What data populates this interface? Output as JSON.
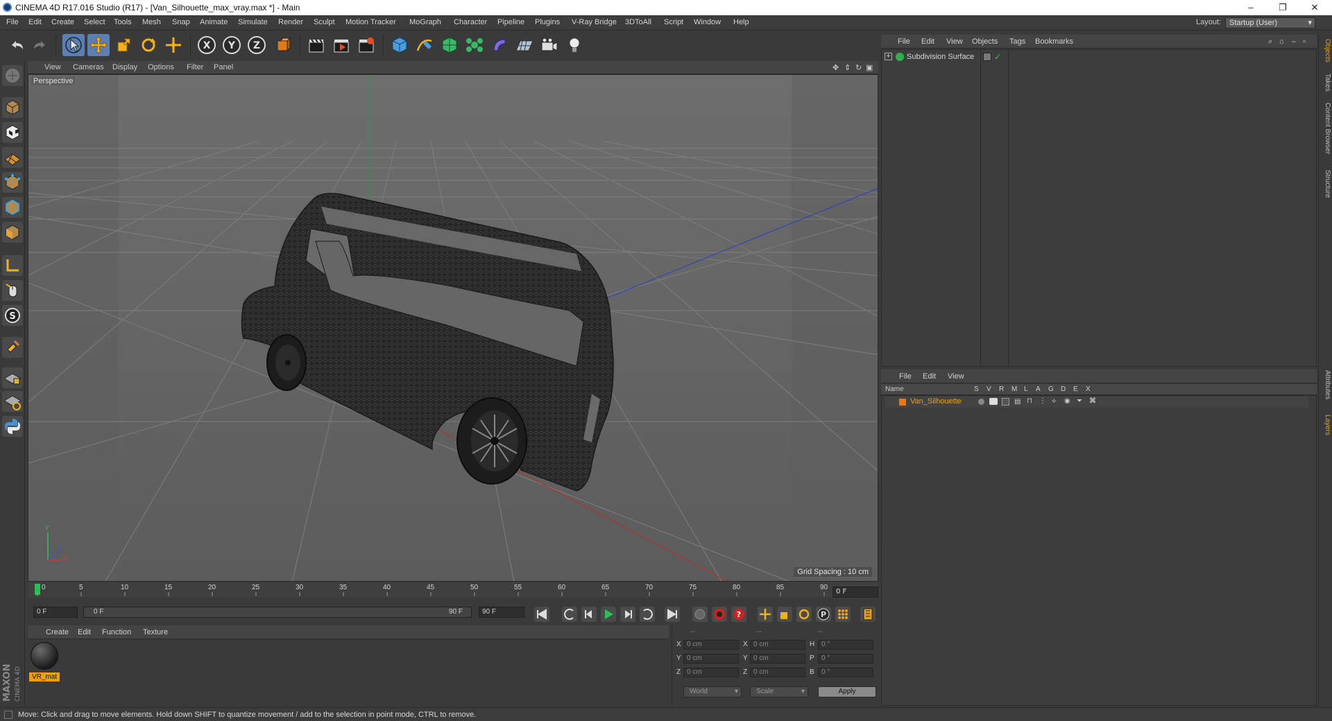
{
  "window": {
    "title": "CINEMA 4D R17.016 Studio (R17) - [Van_Silhouette_max_vray.max *] - Main",
    "minimize": "–",
    "restore": "❐",
    "close": "✕"
  },
  "menu": {
    "items": [
      "File",
      "Edit",
      "Create",
      "Select",
      "Tools",
      "Mesh",
      "Snap",
      "Animate",
      "Simulate",
      "Render",
      "Sculpt",
      "Motion Tracker",
      "MoGraph",
      "Character",
      "Pipeline",
      "Plugins",
      "V-Ray Bridge",
      "3DToAll",
      "Script",
      "Window",
      "Help"
    ],
    "layout_label": "Layout:",
    "layout_value": "Startup (User)"
  },
  "viewport": {
    "menu": [
      "View",
      "Cameras",
      "Display",
      "Options",
      "Filter",
      "Panel"
    ],
    "label": "Perspective",
    "grid_spacing": "Grid Spacing : 10 cm",
    "axis_labels": {
      "y": "Y",
      "x": "X",
      "z": "Z"
    }
  },
  "timeline": {
    "ticks": [
      "0",
      "5",
      "10",
      "15",
      "20",
      "25",
      "30",
      "35",
      "40",
      "45",
      "50",
      "55",
      "60",
      "65",
      "70",
      "75",
      "80",
      "85",
      "90"
    ],
    "frame_end": "0 F"
  },
  "transport": {
    "current_frame": "0 F",
    "range_start": "0 F",
    "range_end": "90 F",
    "max_frame": "90 F"
  },
  "material_manager": {
    "menu": [
      "Create",
      "Edit",
      "Function",
      "Texture"
    ],
    "material_name": "VR_mat"
  },
  "coordinates": {
    "header": [
      "--",
      "--",
      "--"
    ],
    "rows": [
      {
        "a": "X",
        "av": "0 cm",
        "b": "X",
        "bv": "0 cm",
        "c": "H",
        "cv": "0 °"
      },
      {
        "a": "Y",
        "av": "0 cm",
        "b": "Y",
        "bv": "0 cm",
        "c": "P",
        "cv": "0 °"
      },
      {
        "a": "Z",
        "av": "0 cm",
        "b": "Z",
        "bv": "0 cm",
        "c": "B",
        "cv": "0 °"
      }
    ],
    "mode_world": "World",
    "mode_scale": "Scale",
    "apply": "Apply"
  },
  "object_manager": {
    "menu": [
      "File",
      "Edit",
      "View",
      "Objects",
      "Tags",
      "Bookmarks"
    ],
    "objects": [
      {
        "name": "Subdivision Surface"
      }
    ]
  },
  "layer_manager": {
    "menu": [
      "File",
      "Edit",
      "View"
    ],
    "columns": [
      "Name",
      "S",
      "V",
      "R",
      "M",
      "L",
      "A",
      "G",
      "D",
      "E",
      "X"
    ],
    "layers": [
      {
        "name": "Van_Silhouette"
      }
    ]
  },
  "side_tabs": [
    "Objects",
    "Takes",
    "Content Browser",
    "Structure",
    "Attributes",
    "Layers"
  ],
  "status": "Move: Click and drag to move elements. Hold down SHIFT to quantize movement / add to the selection in point mode, CTRL to remove.",
  "branding": {
    "maxon": "MAXON",
    "product": "CINEMA 4D"
  },
  "colors": {
    "accent": "#e8a020",
    "selected_tool": "#5a7fb5",
    "viewport_bg": "#686868"
  }
}
